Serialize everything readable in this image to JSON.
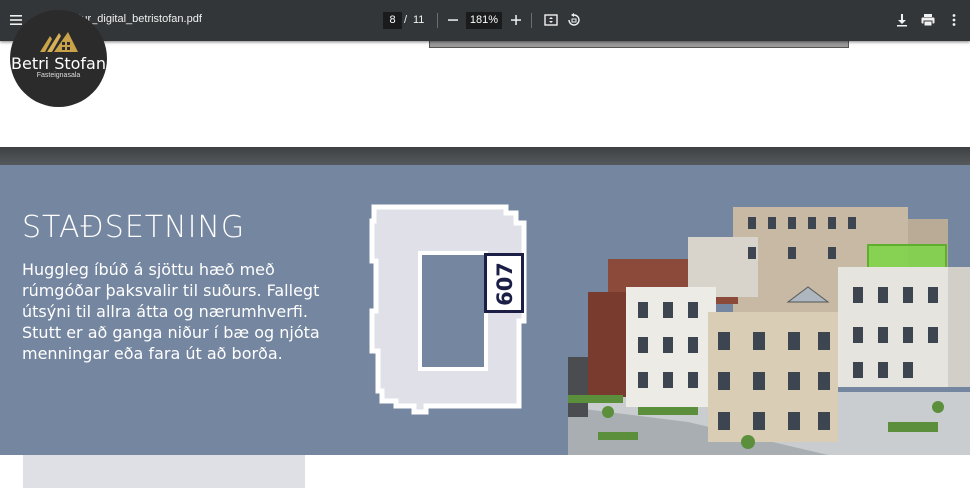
{
  "toolbar": {
    "menu_icon": "hamburger-menu-icon",
    "filename": "Heklureitur_digital_betristofan.pdf",
    "current_page": "8",
    "page_separator": "/",
    "total_pages": "11",
    "zoom": "181%",
    "icons": [
      "zoom-out-icon",
      "zoom-in-icon",
      "fit-page-icon",
      "rotate-icon",
      "download-icon",
      "print-icon",
      "more-options-icon"
    ]
  },
  "logo": {
    "name": "Betri Stofan",
    "subtitle": "Fasteignasala"
  },
  "page": {
    "heading": "STAÐSETNING",
    "description": "Huggleg íbúð á sjöttu hæð með rúmgóðar þaksvalir til suðurs. Fallegt útsýni til allra átta og nærumhverfi. Stutt er að ganga niður í bæ og njóta menningar eða fara út að borða.",
    "apartment_number": "607"
  },
  "colors": {
    "toolbar": "#323639",
    "page_bg": "#7586a0",
    "plan_fill": "#dfe0e8",
    "label_dark": "#1c1f45",
    "highlight": "#7fd44a"
  }
}
